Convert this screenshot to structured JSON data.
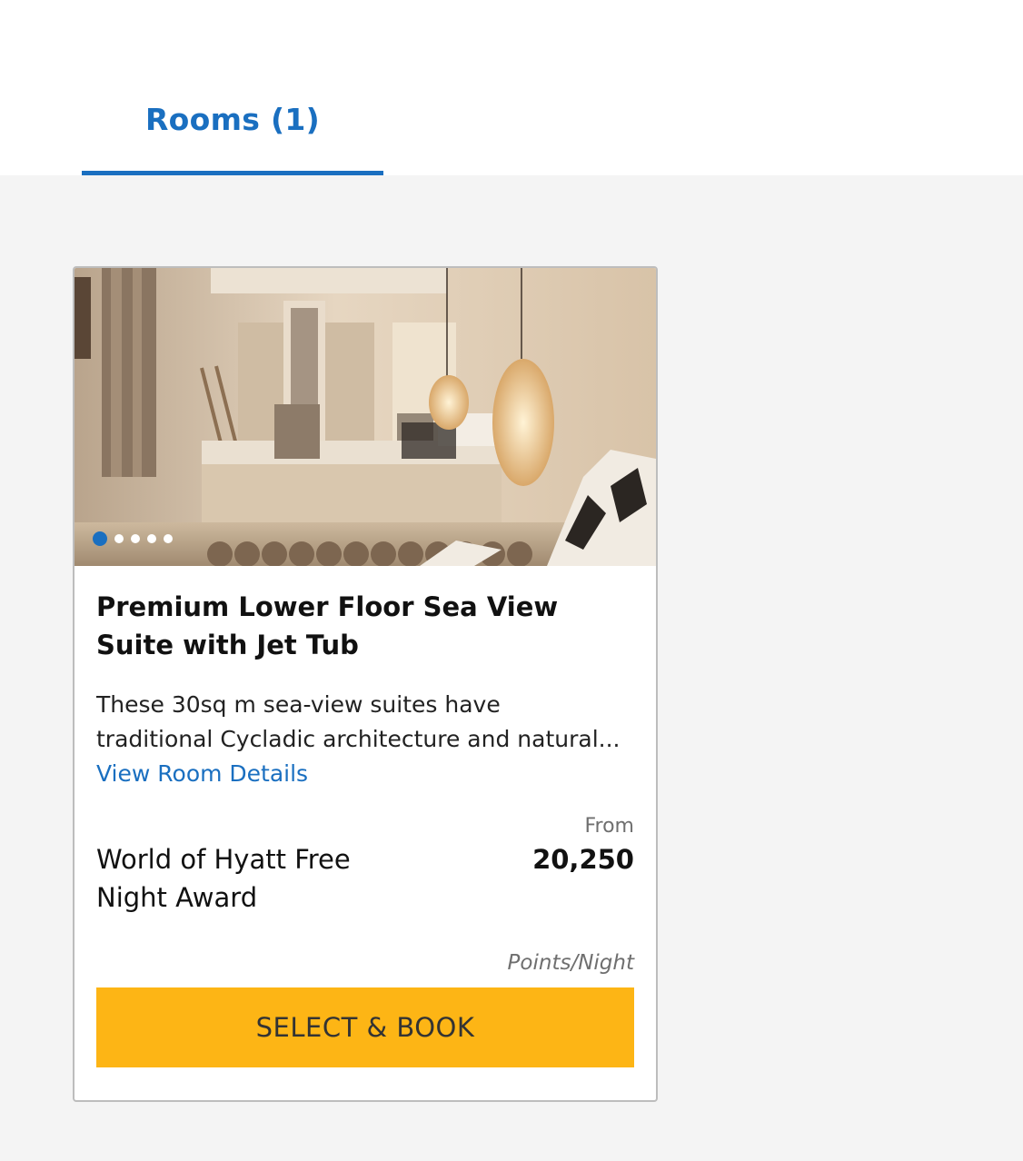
{
  "tabs": [
    {
      "label": "Rooms (1)",
      "active": true
    }
  ],
  "room_card": {
    "title": "Premium Lower Floor Sea View Suite with Jet Tub",
    "description_lines": [
      "These 30sq m sea-view suites have",
      "traditional Cycladic architecture and natural..."
    ],
    "details_link": "View Room Details",
    "rate_name": "World of Hyatt Free Night Award",
    "price_prefix": "From",
    "price": "20,250",
    "price_unit": "Points/Night",
    "cta_label": "SELECT & BOOK",
    "carousel": {
      "total_images": 5,
      "active_index": 0
    }
  },
  "colors": {
    "accent_blue": "#1a6fc0",
    "cta_yellow": "#fdb515",
    "page_bg": "#f4f4f4",
    "card_border": "#bdbdbd"
  },
  "icons": [
    "carousel-dot-icon"
  ]
}
